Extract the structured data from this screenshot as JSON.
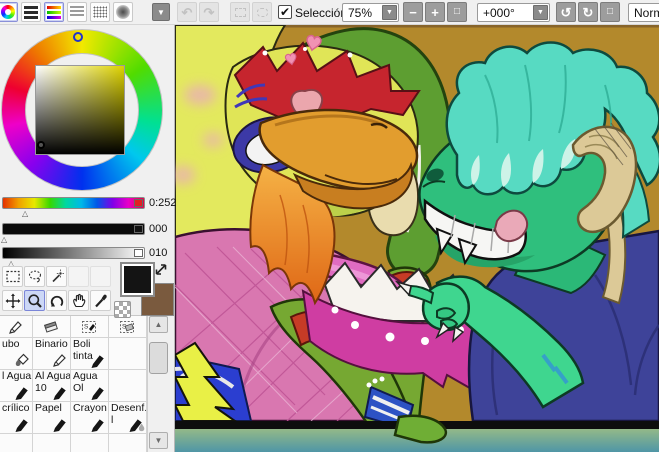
{
  "toolbar": {
    "selection": {
      "label": "Selección",
      "checkmark": "✔",
      "checked": true
    },
    "zoom": {
      "value": "75%"
    },
    "angle": {
      "value": "+000°"
    },
    "blend_mode": "Normal",
    "icons": {
      "dropdown": "▼",
      "undo": "↶",
      "redo": "↷",
      "minus": "−",
      "plus": "+",
      "reset": "□",
      "ccw": "↺",
      "cw": "↻"
    }
  },
  "color_panel": {
    "hue_value": "0:252",
    "saturation_value": "000",
    "value_value": "010",
    "marker": "△"
  },
  "swatches": {
    "foreground": "#141414",
    "background": "#7a5a3e"
  },
  "tools": {
    "active": "zoom"
  },
  "brushes": {
    "rows": [
      [
        "ubo",
        "Binario",
        "Boli tinta",
        ""
      ],
      [
        "l Agua",
        "Al Agua 10",
        "Agua Ol",
        ""
      ],
      [
        "crílico",
        "Papel",
        "Crayon",
        "Desenf. l"
      ]
    ]
  },
  "scrollbar": {
    "up": "▲",
    "down": "▼"
  },
  "canvas": {
    "description": "Digital painting: yellow-green bird character with large orange beak, red crest, blue eye makeup and pink plaid shirt on the left, wrapped by a big green tail ring; grinning green dragon with teal hair, tan curled horn and dark blue shirt pointing a clawed finger on the right; two pink hearts; mustard background; teal table edge at the bottom.",
    "palette": {
      "background": "#b3892c",
      "bird_body": "#e0e557",
      "beak": "#e29d2e",
      "crest_red": "#c6252e",
      "shirt_pink": "#d977b0",
      "ring_green": "#5d9e31",
      "collar_magenta": "#cf3da2",
      "arm_green": "#76a832",
      "band_red": "#c63b26",
      "wristband_blue": "#2d52c4",
      "dragon_green": "#2fbf7d",
      "hair_teal": "#57dac2",
      "horn_tan": "#dcc997",
      "dragon_shirt": "#3e4399",
      "hearts": "#f192b3",
      "table_teal": "#57a0ac"
    }
  }
}
